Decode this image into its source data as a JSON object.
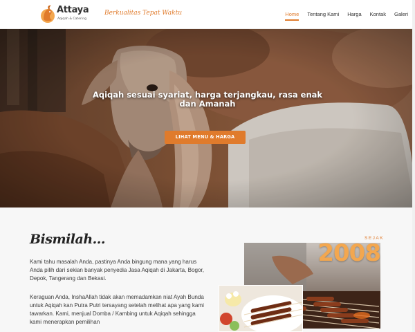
{
  "brand": {
    "name": "Attaya",
    "subtitle": "Aqiqah & Catering",
    "tagline": "Berkualitas Tepat Waktu"
  },
  "nav": {
    "items": [
      {
        "label": "Home",
        "active": true
      },
      {
        "label": "Tentang Kami",
        "active": false
      },
      {
        "label": "Harga",
        "active": false
      },
      {
        "label": "Kontak",
        "active": false
      },
      {
        "label": "Galeri",
        "active": false
      }
    ]
  },
  "hero": {
    "title": "Aqiqah sesuai syariat, harga terjangkau, rasa enak dan Amanah",
    "button_label": "LIHAT MENU & HARGA"
  },
  "about": {
    "heading": "Bismilah...",
    "paragraph1": "Kami tahu masalah Anda, pastinya Anda bingung mana yang harus Anda pilih dari sekian banyak penyedia Jasa Aqiqah di Jakarta, Bogor, Depok, Tangerang dan Bekasi.",
    "paragraph2": "Keraguan Anda, InshaAllah tidak akan memadamkan niat Ayah Bunda untuk Aqiqah kan Putra Putri tersayang setelah melihat apa yang kami tawarkan. Kami, menjual Domba / Kambing untuk Aqiqah sehingga kami menerapkan pemilihan"
  },
  "since": {
    "label": "SEJAK",
    "year": "2008"
  },
  "colors": {
    "accent": "#e07b2c",
    "year": "#f3a74f"
  }
}
